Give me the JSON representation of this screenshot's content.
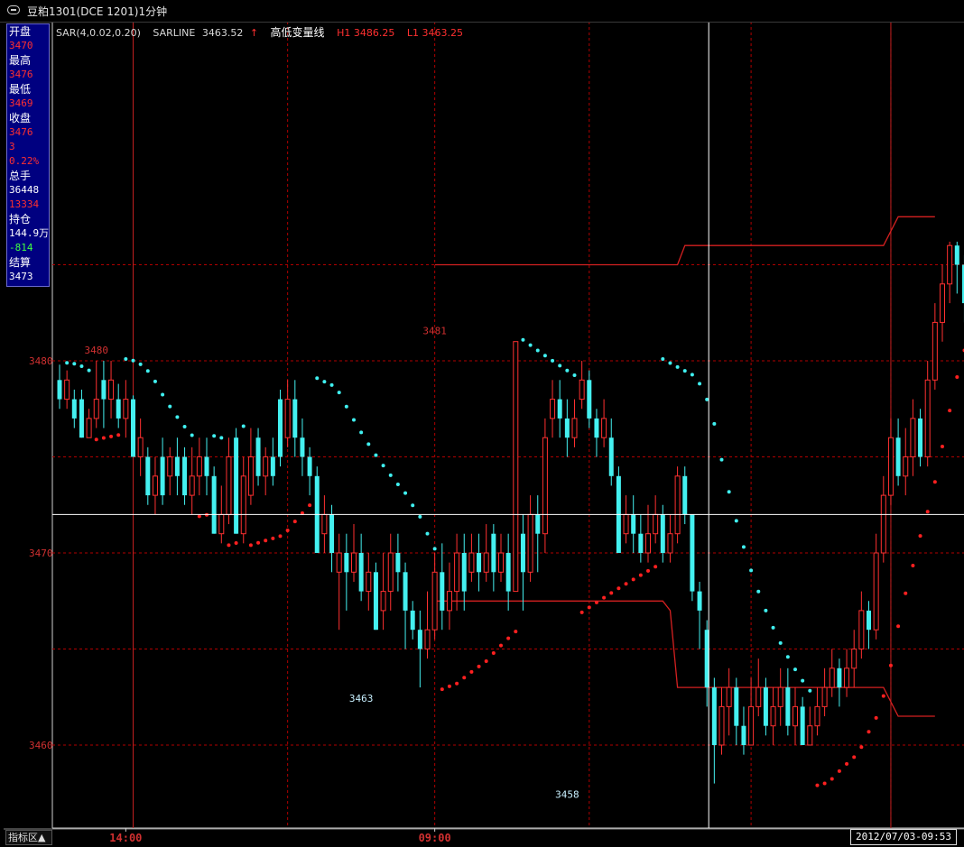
{
  "window": {
    "title": "豆粕1301(DCE 1201)1分钟"
  },
  "info_panel": {
    "open_label": "开盘",
    "open_value": "3470",
    "high_label": "最高",
    "high_value": "3476",
    "low_label": "最低",
    "low_value": "3469",
    "close_label": "收盘",
    "close_value": "3476",
    "change_value": "3",
    "change_pct": "0.22%",
    "volume_label": "总手",
    "volume_value": "36448",
    "volume_sub": "13334",
    "oi_label": "持仓",
    "oi_value": "144.9万",
    "oi_change": "-814",
    "settle_label": "结算",
    "settle_value": "3473"
  },
  "legend": {
    "sar": "SAR(4,0.02,0.20)",
    "sarline_label": "SARLINE",
    "sarline_value": "3463.52",
    "sarline_arrow": "↑",
    "hl_label": "高低变量线",
    "h1": "H1  3486.25",
    "l1": "L1  3463.25"
  },
  "bottom": {
    "tab_label": "指标区▲",
    "cursor_time": "2012/07/03-09:53"
  },
  "colors": {
    "up": "#ff3030",
    "down": "#44f0f0",
    "grid": "#b00000",
    "sar_up": "#ff2020",
    "sar_down": "#40f0f0",
    "hlline": "#d42020",
    "axis_text": "#d03030"
  },
  "chart_data": {
    "type": "candlestick",
    "y_axis": {
      "ticks": [
        3460,
        3470,
        3480
      ],
      "ylim": [
        3455.5,
        3489.5
      ]
    },
    "x_axis": {
      "ticks": [
        {
          "label": "14:00",
          "index": 9
        },
        {
          "label": "09:00",
          "index": 51
        }
      ]
    },
    "annotations": [
      {
        "label": "3480",
        "index": 5,
        "price": 3480
      },
      {
        "label": "3481",
        "index": 51,
        "price": 3481
      },
      {
        "label": "3463",
        "index": 41,
        "price": 3463
      },
      {
        "label": "3458",
        "index": 69,
        "price": 3458
      }
    ],
    "hline_price": 3472,
    "cursor_index": 88,
    "candles": [
      [
        3479,
        3478,
        3479.8,
        3477.5
      ],
      [
        3478,
        3479,
        3479.5,
        3477.5
      ],
      [
        3478,
        3477,
        3478.5,
        3476.5
      ],
      [
        3478,
        3476,
        3478.5,
        3476
      ],
      [
        3476,
        3477,
        3477.5,
        3476
      ],
      [
        3477,
        3478,
        3480,
        3476.5
      ],
      [
        3479,
        3478,
        3480,
        3476.5
      ],
      [
        3478,
        3479,
        3480,
        3477
      ],
      [
        3478,
        3477,
        3478.8,
        3476.5
      ],
      [
        3477,
        3478,
        3479,
        3476
      ],
      [
        3478,
        3475,
        3478.2,
        3475
      ],
      [
        3475,
        3476,
        3477,
        3474
      ],
      [
        3475,
        3473,
        3475.5,
        3472.5
      ],
      [
        3473,
        3474,
        3475,
        3472
      ],
      [
        3475,
        3473,
        3476,
        3472.5
      ],
      [
        3474,
        3475,
        3475.5,
        3473
      ],
      [
        3475,
        3474,
        3476,
        3473
      ],
      [
        3475,
        3473,
        3475.5,
        3472.5
      ],
      [
        3473,
        3474,
        3475.5,
        3472
      ],
      [
        3474,
        3475,
        3476,
        3473
      ],
      [
        3475,
        3474,
        3476,
        3473
      ],
      [
        3474,
        3471,
        3474.5,
        3471
      ],
      [
        3471,
        3472,
        3473.5,
        3470.5
      ],
      [
        3472,
        3475,
        3476,
        3471.5
      ],
      [
        3476,
        3471,
        3476.5,
        3471
      ],
      [
        3471,
        3474,
        3475,
        3470.5
      ],
      [
        3473,
        3475,
        3476.5,
        3472.5
      ],
      [
        3476,
        3474,
        3476.5,
        3473.5
      ],
      [
        3474,
        3475,
        3475.5,
        3473
      ],
      [
        3475,
        3474,
        3476,
        3473.5
      ],
      [
        3478,
        3475,
        3478.5,
        3474.5
      ],
      [
        3476,
        3478,
        3479,
        3475.5
      ],
      [
        3478,
        3476,
        3479,
        3475
      ],
      [
        3476,
        3475,
        3477,
        3474
      ],
      [
        3475,
        3474,
        3475.5,
        3473
      ],
      [
        3474,
        3470,
        3474.5,
        3470
      ],
      [
        3471,
        3472,
        3473,
        3470
      ],
      [
        3472,
        3470,
        3472.5,
        3469
      ],
      [
        3469,
        3470,
        3471,
        3466
      ],
      [
        3470,
        3469,
        3471,
        3467
      ],
      [
        3469,
        3470,
        3471.5,
        3468.5
      ],
      [
        3470,
        3468,
        3471,
        3467.5
      ],
      [
        3468,
        3469,
        3470,
        3467
      ],
      [
        3469,
        3466,
        3469.5,
        3466
      ],
      [
        3467,
        3468,
        3470,
        3466
      ],
      [
        3468,
        3470,
        3471,
        3467
      ],
      [
        3470,
        3469,
        3471,
        3468
      ],
      [
        3469,
        3467,
        3469.5,
        3465
      ],
      [
        3467,
        3466,
        3467.5,
        3465.5
      ],
      [
        3466,
        3465,
        3467,
        3463
      ],
      [
        3465,
        3466,
        3468,
        3464.5
      ],
      [
        3466,
        3469,
        3470,
        3465.5
      ],
      [
        3469,
        3467,
        3470.5,
        3466
      ],
      [
        3467,
        3468,
        3469.5,
        3466
      ],
      [
        3468,
        3470,
        3471,
        3467
      ],
      [
        3470,
        3468,
        3471,
        3467
      ],
      [
        3469,
        3470,
        3471,
        3468.5
      ],
      [
        3470,
        3469,
        3471,
        3468
      ],
      [
        3469,
        3470,
        3471.5,
        3468.5
      ],
      [
        3471,
        3469,
        3471.5,
        3468
      ],
      [
        3469,
        3470,
        3471,
        3468.5
      ],
      [
        3470,
        3468,
        3471,
        3467
      ],
      [
        3468,
        3481,
        3481,
        3468
      ],
      [
        3471,
        3469,
        3472,
        3467
      ],
      [
        3469,
        3472,
        3473,
        3468.5
      ],
      [
        3472,
        3471,
        3473,
        3469
      ],
      [
        3471,
        3476,
        3477,
        3470
      ],
      [
        3477,
        3478,
        3479,
        3476
      ],
      [
        3478,
        3477,
        3479,
        3476
      ],
      [
        3477,
        3476,
        3478,
        3475
      ],
      [
        3476,
        3477,
        3478,
        3475.5
      ],
      [
        3478,
        3479,
        3480,
        3477.5
      ],
      [
        3479,
        3477,
        3479.5,
        3476.5
      ],
      [
        3477,
        3476,
        3477.5,
        3475
      ],
      [
        3476,
        3477,
        3478,
        3475.5
      ],
      [
        3476,
        3474,
        3477,
        3473.5
      ],
      [
        3474,
        3470,
        3474.5,
        3470
      ],
      [
        3471,
        3472,
        3473,
        3470.5
      ],
      [
        3472,
        3471,
        3473,
        3470
      ],
      [
        3471,
        3470,
        3472,
        3469.5
      ],
      [
        3470,
        3471,
        3472.5,
        3469.5
      ],
      [
        3471,
        3472,
        3473,
        3470.5
      ],
      [
        3472,
        3470,
        3472.5,
        3469.5
      ],
      [
        3470,
        3471,
        3472,
        3469.5
      ],
      [
        3471,
        3474,
        3474.5,
        3470.5
      ],
      [
        3474,
        3472,
        3474.5,
        3471.5
      ],
      [
        3472,
        3468,
        3472,
        3467.5
      ],
      [
        3468,
        3467,
        3468.5,
        3465
      ],
      [
        3466,
        3463,
        3466.5,
        3462
      ],
      [
        3463,
        3460,
        3463.5,
        3458
      ],
      [
        3460,
        3462,
        3463,
        3459.5
      ],
      [
        3462,
        3463,
        3464,
        3460.5
      ],
      [
        3463,
        3461,
        3463.5,
        3460
      ],
      [
        3461,
        3460,
        3462,
        3459.5
      ],
      [
        3460,
        3462,
        3463.5,
        3460
      ],
      [
        3462,
        3463,
        3464.5,
        3461.5
      ],
      [
        3463,
        3461,
        3463.5,
        3460.5
      ],
      [
        3461,
        3462,
        3463,
        3460
      ],
      [
        3462,
        3463,
        3464,
        3461
      ],
      [
        3463,
        3461,
        3464,
        3460.5
      ],
      [
        3461,
        3462,
        3463,
        3460
      ],
      [
        3462,
        3460,
        3462.5,
        3460
      ],
      [
        3460,
        3461,
        3462,
        3460
      ],
      [
        3461,
        3462,
        3463,
        3460.5
      ],
      [
        3462,
        3463,
        3464,
        3461.5
      ],
      [
        3463,
        3464,
        3465,
        3462.5
      ],
      [
        3464,
        3463,
        3464.5,
        3462
      ],
      [
        3463,
        3464,
        3465,
        3462.5
      ],
      [
        3464,
        3465,
        3466,
        3463
      ],
      [
        3465,
        3467,
        3468,
        3464.5
      ],
      [
        3467,
        3466,
        3467.5,
        3465
      ],
      [
        3466,
        3470,
        3471,
        3465.5
      ],
      [
        3470,
        3473,
        3474,
        3469.5
      ],
      [
        3473,
        3476,
        3477,
        3472.5
      ],
      [
        3476,
        3474,
        3477,
        3473.5
      ],
      [
        3474,
        3475,
        3476.5,
        3473
      ],
      [
        3475,
        3477,
        3478,
        3474
      ],
      [
        3477,
        3475,
        3477.5,
        3474.5
      ],
      [
        3475,
        3479,
        3480,
        3474.5
      ],
      [
        3479,
        3482,
        3483,
        3478.5
      ],
      [
        3482,
        3484,
        3485,
        3481
      ],
      [
        3484,
        3486,
        3486.2,
        3483
      ],
      [
        3486,
        3485,
        3486.2,
        3483.5
      ],
      [
        3485,
        3483,
        3485.5,
        3482
      ],
      [
        3483,
        3480,
        3483.5,
        3479
      ],
      [
        3480,
        3482,
        3483.5,
        3479.5
      ]
    ]
  }
}
